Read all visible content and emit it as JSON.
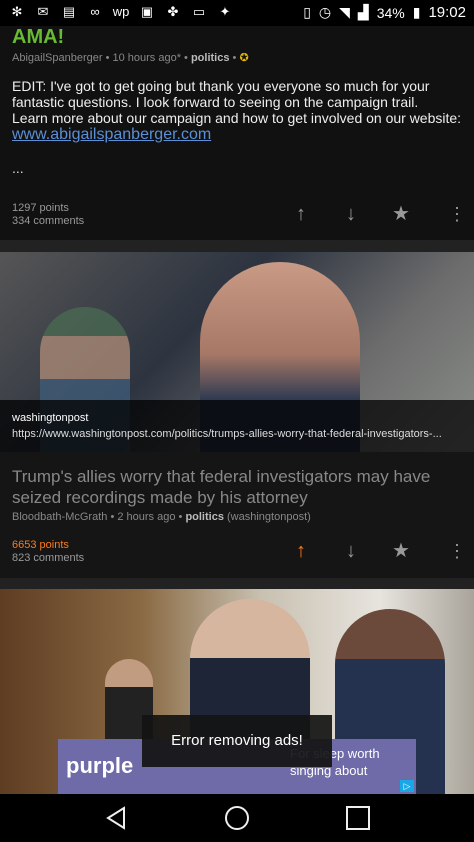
{
  "status_bar": {
    "left_icons": [
      "slack-icon",
      "mail-icon",
      "message-icon",
      "voicemail-icon",
      "wp-icon",
      "photo-icon",
      "pinwheel-icon",
      "laptop-icon",
      "twitter-icon"
    ],
    "battery": "34%",
    "time": "19:02"
  },
  "post1": {
    "title": "AMA!",
    "author": "AbigailSpanberger",
    "time": "10 hours ago*",
    "subreddit": "politics",
    "body_line1": "EDIT: I've got to get going but thank you everyone so much for your fantastic questions. I look forward to seeing on the campaign trail.",
    "body_line2": "Learn more about our campaign and how to get involved on our website:",
    "link": "www.abigailspanberger.com",
    "ellipsis": "...",
    "points": "1297 points",
    "comments": "334 comments"
  },
  "post2": {
    "domain": "washingtonpost",
    "url": "https://www.washingtonpost.com/politics/trumps-allies-worry-that-federal-investigators-...",
    "title": "Trump's allies worry that federal investigators may have seized recordings made by his attorney",
    "author": "Bloodbath-McGrath",
    "time": "2 hours ago",
    "subreddit": "politics",
    "source": "(washingtonpost)",
    "points": "6653 points",
    "comments": "823 comments"
  },
  "ad": {
    "brand": "purple",
    "text": "For sleep worth singing about"
  },
  "toast": "Error removing ads!",
  "colors": {
    "accent_green": "#66bb33",
    "upvote_orange": "#ff7a1a",
    "link_blue": "#5b8fd6"
  }
}
